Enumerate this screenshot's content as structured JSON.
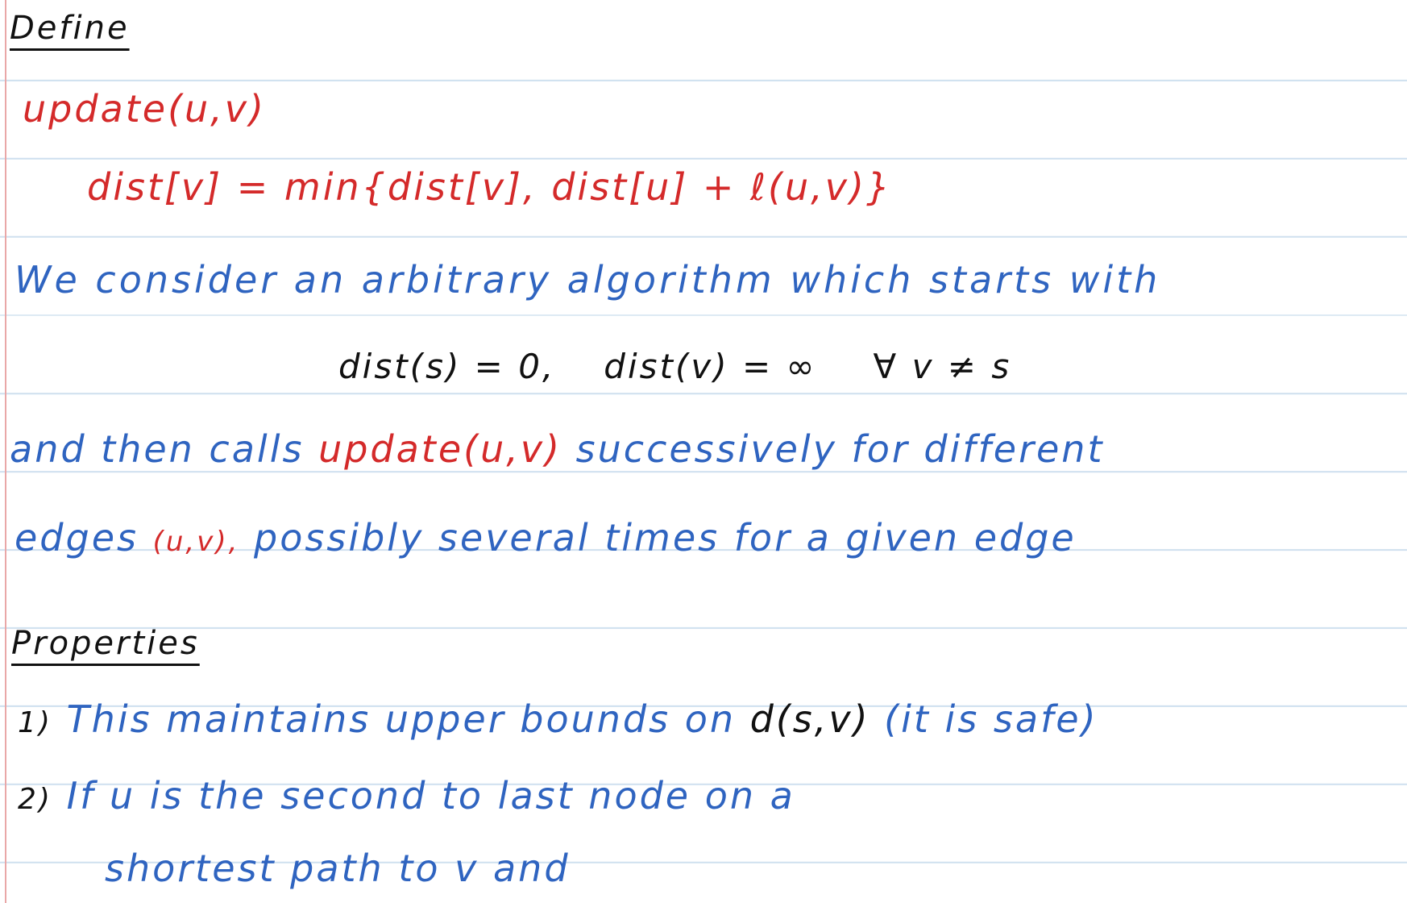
{
  "notes": {
    "define_heading": "Define",
    "update_signature": "update(u,v)",
    "update_body": "dist[v] = min{dist[v], dist[u] + ℓ(u,v)}",
    "para_line1": "We consider an arbitrary algorithm which starts with",
    "init_dist_s": "dist(s) = 0,",
    "init_dist_v": "dist(v) = ∞",
    "init_forall": "∀ v ≠ s",
    "para_line3_start": "and then calls",
    "para_line3_update": "update(u,v)",
    "para_line3_end": "successively for different",
    "para_line4_start": "edges",
    "para_line4_edge": "(u,v),",
    "para_line4_end": "possibly several times for a given edge",
    "properties_heading": "Properties",
    "prop1_number": "1)",
    "prop1_text": "This maintains upper bounds on",
    "prop1_math": "d(s,v)",
    "prop1_note": "(it is safe)",
    "prop2_number": "2)",
    "prop2_text": "If u is the second to last node on a",
    "prop2_cont": "shortest path to v and"
  },
  "colors": {
    "red_ink": "#d42a2a",
    "blue_ink": "#2f64c0",
    "black_ink": "#111111",
    "rule_line": "#cfe0ef",
    "margin_line": "#e9a7a7"
  }
}
